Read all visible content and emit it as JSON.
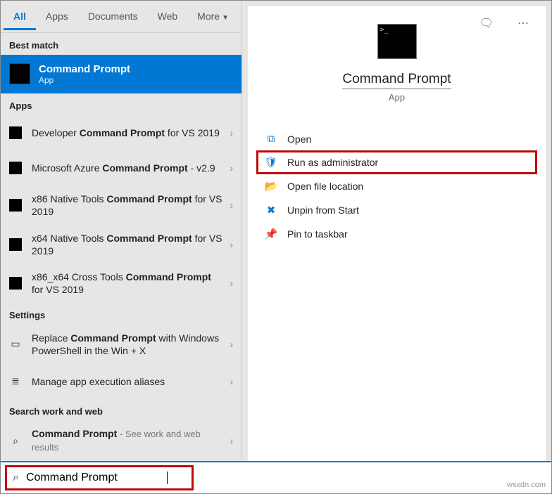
{
  "tabs": {
    "all": "All",
    "apps": "Apps",
    "documents": "Documents",
    "web": "Web",
    "more": "More"
  },
  "sections": {
    "best_match": "Best match",
    "apps": "Apps",
    "settings": "Settings",
    "search_web": "Search work and web"
  },
  "best_match": {
    "title": "Command Prompt",
    "subtitle": "App"
  },
  "apps_list": [
    {
      "pre": "Developer ",
      "hl": "Command Prompt",
      "post": " for VS 2019"
    },
    {
      "pre": "Microsoft Azure ",
      "hl": "Command Prompt",
      "post": " - v2.9"
    },
    {
      "pre": "x86 Native Tools ",
      "hl": "Command Prompt",
      "post": " for VS 2019"
    },
    {
      "pre": "x64 Native Tools ",
      "hl": "Command Prompt",
      "post": " for VS 2019"
    },
    {
      "pre": "x86_x64 Cross Tools ",
      "hl": "Command Prompt",
      "post": " for VS 2019"
    }
  ],
  "settings_list": [
    {
      "pre": "Replace ",
      "hl": "Command Prompt",
      "post": " with Windows PowerShell in the Win + X"
    },
    {
      "plain": "Manage app execution aliases"
    }
  ],
  "web_list": [
    {
      "hl": "Command Prompt",
      "tail": " - See work and web results"
    }
  ],
  "preview": {
    "title": "Command Prompt",
    "subtitle": "App"
  },
  "actions": {
    "open": "Open",
    "run_admin": "Run as administrator",
    "open_loc": "Open file location",
    "unpin_start": "Unpin from Start",
    "pin_taskbar": "Pin to taskbar"
  },
  "search": {
    "value": "Command Prompt"
  },
  "watermark": "wsxdn.com"
}
